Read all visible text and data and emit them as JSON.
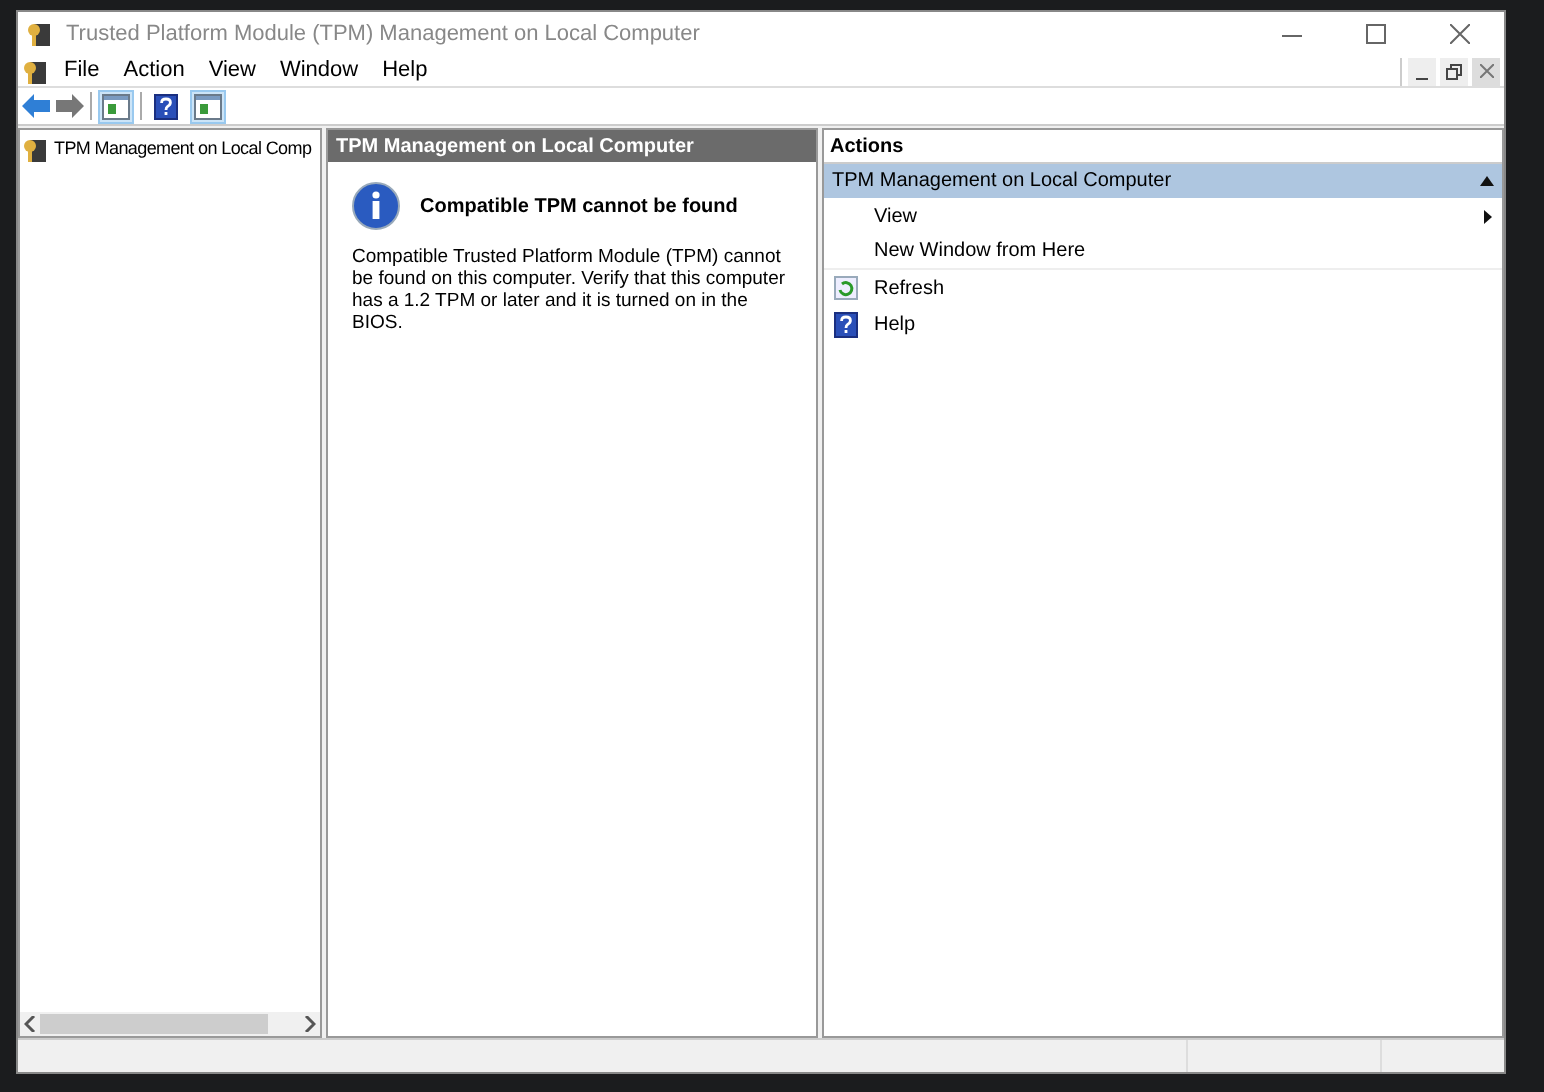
{
  "window": {
    "title": "Trusted Platform Module (TPM) Management on Local Computer"
  },
  "menu": [
    "File",
    "Action",
    "View",
    "Window",
    "Help"
  ],
  "tree": {
    "items": [
      {
        "label": "TPM Management on Local Comp"
      }
    ]
  },
  "main": {
    "header": "TPM Management on Local Computer",
    "message": {
      "title": "Compatible TPM cannot be found",
      "body": "Compatible Trusted Platform Module (TPM) cannot be found on this computer. Verify that this computer has a 1.2 TPM or later and it is turned on in the BIOS."
    }
  },
  "actions": {
    "header": "Actions",
    "section": {
      "title": "TPM Management on Local Computer",
      "expanded": true
    },
    "items": [
      {
        "label": "View",
        "kind": "submenu"
      },
      {
        "label": "New Window from Here",
        "kind": "plain"
      },
      {
        "label": "Refresh",
        "kind": "refresh"
      },
      {
        "label": "Help",
        "kind": "help"
      }
    ]
  }
}
